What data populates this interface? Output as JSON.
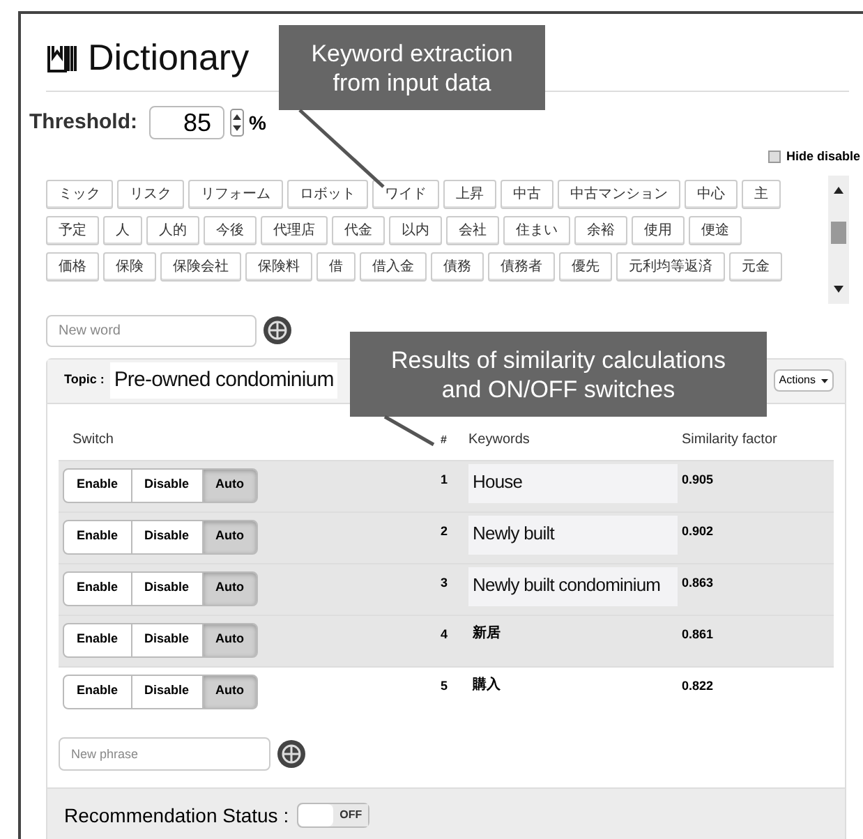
{
  "title": "Dictionary",
  "threshold": {
    "label": "Threshold:",
    "value": "85",
    "unit": "%"
  },
  "hide_disable": {
    "label": "Hide disable",
    "checked": false
  },
  "tag_rows": [
    [
      "ミック",
      "リスク",
      "リフォーム",
      "ロボット",
      "ワイド",
      "上昇",
      "中古",
      "中古マンション",
      "中心",
      "主"
    ],
    [
      "予定",
      "人",
      "人的",
      "今後",
      "代理店",
      "代金",
      "以内",
      "会社",
      "住まい",
      "余裕",
      "使用",
      "便途"
    ],
    [
      "価格",
      "保険",
      "保険会社",
      "保険料",
      "借",
      "借入金",
      "債務",
      "債務者",
      "優先",
      "元利均等返済",
      "元金"
    ]
  ],
  "new_word": {
    "placeholder": "New word"
  },
  "topic": {
    "label": "Topic :",
    "value": "Pre-owned condominium",
    "actions": "Actions"
  },
  "table": {
    "columns": [
      "Switch",
      "#",
      "Keywords",
      "Similarity factor"
    ],
    "rows": [
      {
        "options": [
          {
            "label": "Enable",
            "selected": false
          },
          {
            "label": "Disable",
            "selected": false
          },
          {
            "label": "Auto",
            "selected": true
          }
        ],
        "number": "1",
        "keyword": "House",
        "translated": true,
        "score": "0.905",
        "shaded": true
      },
      {
        "options": [
          {
            "label": "Enable",
            "selected": false
          },
          {
            "label": "Disable",
            "selected": false
          },
          {
            "label": "Auto",
            "selected": true
          }
        ],
        "number": "2",
        "keyword": "Newly built",
        "translated": true,
        "score": "0.902",
        "shaded": true
      },
      {
        "options": [
          {
            "label": "Enable",
            "selected": false
          },
          {
            "label": "Disable",
            "selected": false
          },
          {
            "label": "Auto",
            "selected": true
          }
        ],
        "number": "3",
        "keyword": "Newly built condominium",
        "translated": true,
        "score": "0.863",
        "shaded": true
      },
      {
        "options": [
          {
            "label": "Enable",
            "selected": false
          },
          {
            "label": "Disable",
            "selected": false
          },
          {
            "label": "Auto",
            "selected": true
          }
        ],
        "number": "4",
        "keyword": "新居",
        "translated": false,
        "score": "0.861",
        "shaded": true
      },
      {
        "options": [
          {
            "label": "Enable",
            "selected": false
          },
          {
            "label": "Disable",
            "selected": false
          },
          {
            "label": "Auto",
            "selected": true
          }
        ],
        "number": "5",
        "keyword": "購入",
        "translated": false,
        "score": "0.822",
        "shaded": false
      }
    ]
  },
  "new_phrase": {
    "placeholder": "New phrase"
  },
  "recommendation": {
    "label": "Recommendation Status :",
    "toggle": {
      "label": "OFF",
      "on": false
    }
  },
  "callouts": [
    "Keyword extraction\nfrom input data",
    "Results of similarity calculations\nand ON/OFF switches"
  ]
}
